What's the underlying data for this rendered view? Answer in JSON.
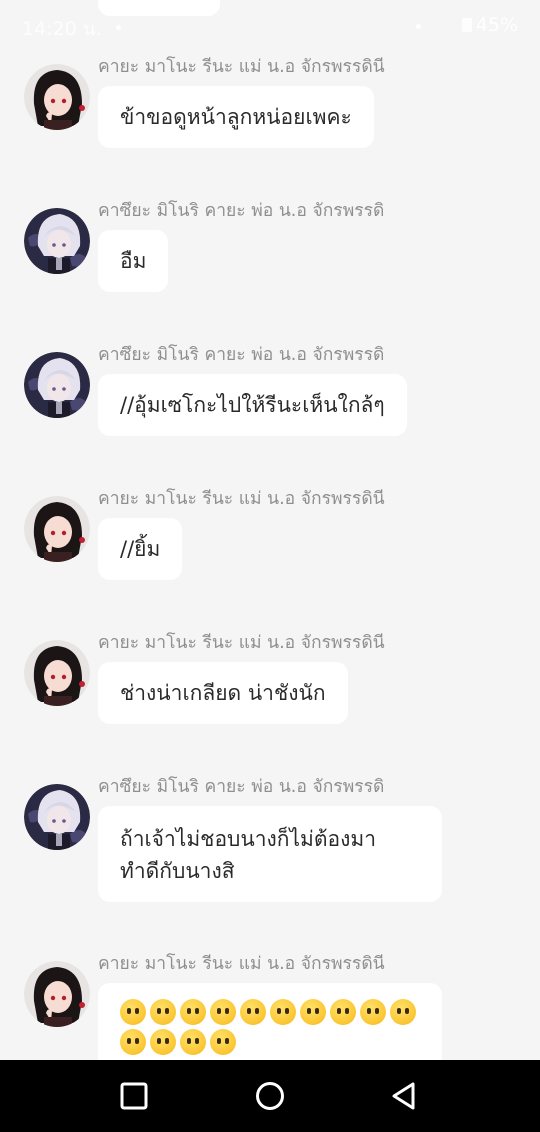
{
  "status_bar": {
    "time": "14:20 น.",
    "battery": "45%"
  },
  "messages": [
    {
      "sender": "คายะ มาโนะ รีนะ แม่ น.อ จักรพรรดินี",
      "avatar": "avatar-dark-hair",
      "text": "ข้าขอดูหน้าลูกหน่อยเพคะ"
    },
    {
      "sender": "คาซึยะ มิโนริ คายะ พ่อ น.อ จักรพรรดิ",
      "avatar": "avatar-silver-hair",
      "text": "อืม"
    },
    {
      "sender": "คาซึยะ มิโนริ คายะ พ่อ น.อ จักรพรรดิ",
      "avatar": "avatar-silver-hair",
      "text": "//อุ้มเซโกะไปให้รีนะเห็นใกล้ๆ"
    },
    {
      "sender": "คายะ มาโนะ รีนะ แม่ น.อ จักรพรรดินี",
      "avatar": "avatar-dark-hair",
      "text": "//ยิ้ม"
    },
    {
      "sender": "คายะ มาโนะ รีนะ แม่ น.อ จักรพรรดินี",
      "avatar": "avatar-dark-hair",
      "text": "ช่างน่าเกลียด น่าชังนัก"
    },
    {
      "sender": "คาซึยะ มิโนริ คายะ พ่อ น.อ จักรพรรดิ",
      "avatar": "avatar-silver-hair",
      "text": "ถ้าเจ้าไม่ชอบนางก็ไม่ต้องมา\nทำดีกับนางสิ"
    },
    {
      "sender": "คายะ มาโนะ รีนะ แม่ น.อ จักรพรรดินี",
      "avatar": "avatar-dark-hair",
      "text": "😶😶😶😶😶😶😶😶😶😶😶😶😶😶",
      "emoji_name": "face-without-mouth-emoji",
      "emoji_count": 14
    }
  ],
  "nav_bar": {
    "recents_icon": "square-recents-icon",
    "home_icon": "circle-home-icon",
    "back_icon": "triangle-back-icon"
  },
  "colors": {
    "background": "#f5f5f5",
    "bubble": "#ffffff",
    "sender_text": "#8f8f8f",
    "message_text": "#2a2a2a",
    "nav_bar": "#000000"
  }
}
